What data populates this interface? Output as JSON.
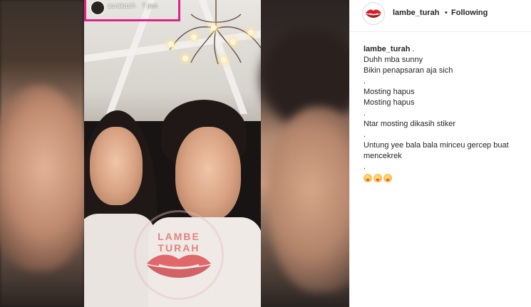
{
  "story": {
    "username": "aurakasih",
    "time": "7 jam"
  },
  "post": {
    "author": "lambe_turah",
    "separator": "•",
    "follow_status": "Following"
  },
  "caption": {
    "author": "lambe_turah",
    "lines": [
      "Duhh mba sunny",
      "Bikin penapsaran aja sich",
      ".",
      "Mosting hapus",
      "Mosting hapus",
      ".",
      "Ntar mosting dikasih stiker",
      ".",
      "Untung yee bala bala minceu gercep buat mencekrek",
      "."
    ],
    "emojis": [
      "face-savoring-emoji",
      "face-savoring-emoji",
      "face-savoring-emoji"
    ]
  },
  "watermark": {
    "text": "LAMBE TURAH"
  },
  "colors": {
    "highlight_box": "#e0218a",
    "brand_red": "#d81f26"
  }
}
